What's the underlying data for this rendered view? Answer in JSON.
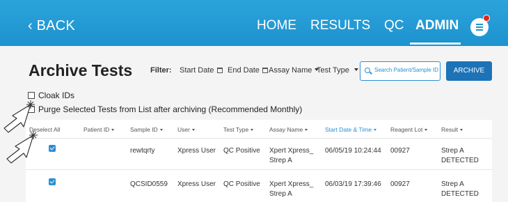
{
  "header": {
    "back_label": "‹ BACK",
    "nav": {
      "home": "HOME",
      "results": "RESULTS",
      "qc": "QC",
      "admin": "ADMIN"
    },
    "accent_color": "#1d93cf",
    "notification_dot_color": "#e0261c"
  },
  "page": {
    "title": "Archive Tests"
  },
  "filters": {
    "label": "Filter:",
    "start_date": "Start Date",
    "end_date": "End Date",
    "assay_name": "Assay Name",
    "test_type": "Test Type",
    "search_placeholder": "Search Patient/Sample ID",
    "archive_button": "ARCHIVE"
  },
  "options": {
    "cloak_ids": "Cloak IDs",
    "purge": "Purge Selected Tests from List after archiving (Recommended Monthly)"
  },
  "table": {
    "columns": {
      "deselect_all": "Deselect All",
      "patient_id": "Patient ID",
      "sample_id": "Sample ID",
      "user": "User",
      "test_type": "Test Type",
      "assay_name": "Assay Name",
      "start_date_time": "Start Date & Time",
      "reagent_lot": "Reagent Lot",
      "result": "Result"
    },
    "rows": [
      {
        "selected": true,
        "patient_id": "",
        "sample_id": "rewtqrty",
        "user": "Xpress User",
        "test_type": "QC Positive",
        "assay_line1": "Xpert Xpress_",
        "assay_line2": "Strep A",
        "start_date_time": "06/05/19 10:24:44",
        "reagent_lot": "00927",
        "result_line1": "Strep A",
        "result_line2": "DETECTED"
      },
      {
        "selected": true,
        "patient_id": "",
        "sample_id": "QCSID0559",
        "user": "Xpress User",
        "test_type": "QC Positive",
        "assay_line1": "Xpert Xpress_",
        "assay_line2": "Strep A",
        "start_date_time": "06/03/19 17:39:46",
        "reagent_lot": "00927",
        "result_line1": "Strep A",
        "result_line2": "DETECTED"
      }
    ]
  }
}
